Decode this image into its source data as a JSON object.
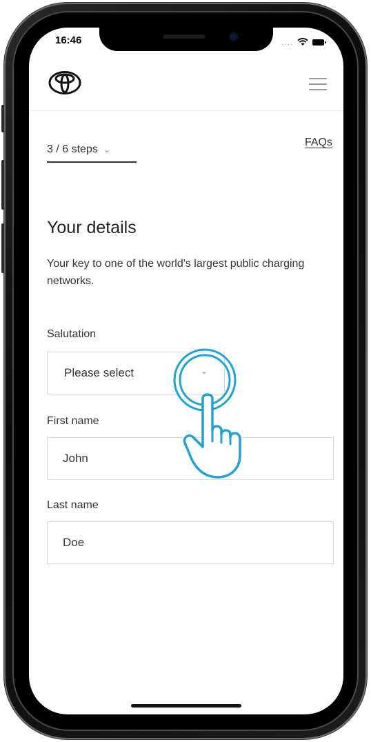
{
  "status_bar": {
    "time": "16:46",
    "signal": "...."
  },
  "header": {
    "logo_icon": "toyota-logo",
    "menu_icon": "hamburger-icon"
  },
  "progress": {
    "steps_label": "3 / 6 steps",
    "steps_chevron": "⌄"
  },
  "faqs_link": "FAQs",
  "page": {
    "title": "Your details",
    "subtitle": "Your key to one of the world's largest public charging networks."
  },
  "form": {
    "salutation": {
      "label": "Salutation",
      "value": "Please select",
      "chevron": "⌄"
    },
    "first_name": {
      "label": "First name",
      "value": "John"
    },
    "last_name": {
      "label": "Last name",
      "value": "Doe"
    }
  },
  "colors": {
    "accent": "#1fa3d6",
    "text": "#333333",
    "border": "#dcdcdc"
  }
}
